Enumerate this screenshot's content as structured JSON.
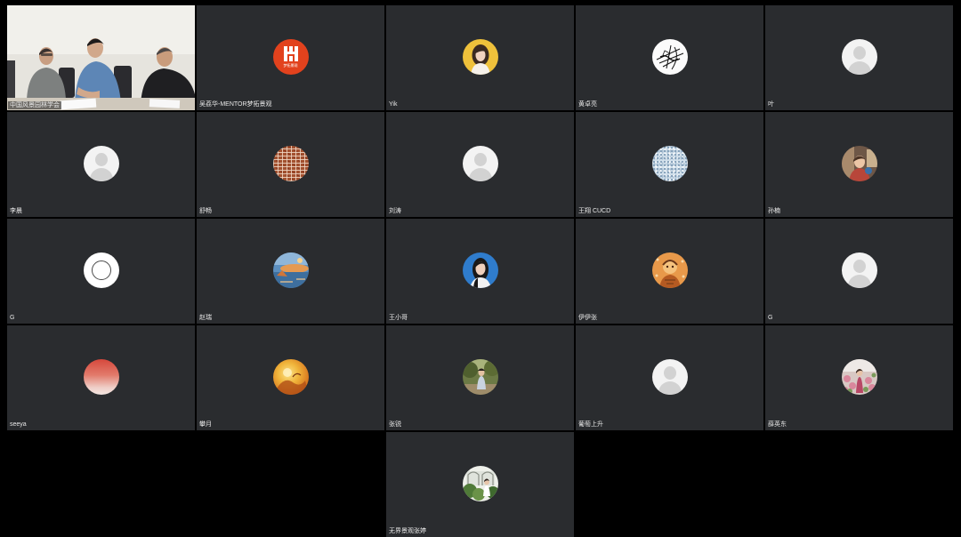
{
  "meeting": {
    "layout": "gallery",
    "colors": {
      "background": "#000000",
      "tile": "#2a2c2f",
      "active_border": "#8fd39a",
      "label": "#e8e8e8"
    }
  },
  "participants": [
    {
      "name": "中国风景园林学会",
      "avatar": "camera-video",
      "active_speaker": true
    },
    {
      "name": "吴荔华-MENTOR梦拓景观",
      "avatar": "logo-image",
      "logo_text": "梦拓景观"
    },
    {
      "name": "Yik",
      "avatar": "photo-avatar"
    },
    {
      "name": "黄卓亮",
      "avatar": "sketch-avatar"
    },
    {
      "name": "叶",
      "avatar": "default-avatar-icon"
    },
    {
      "name": "李晨",
      "avatar": "default-avatar-icon"
    },
    {
      "name": "舒畅",
      "avatar": "pattern-avatar"
    },
    {
      "name": "刘涛",
      "avatar": "default-avatar-icon"
    },
    {
      "name": "王翔 CUCD",
      "avatar": "pattern-avatar"
    },
    {
      "name": "孙楠",
      "avatar": "photo-avatar"
    },
    {
      "name": "G",
      "avatar": "ring-avatar"
    },
    {
      "name": "赵瑞",
      "avatar": "painting-avatar"
    },
    {
      "name": "王小哥",
      "avatar": "photo-avatar"
    },
    {
      "name": "伊伊张",
      "avatar": "illustration-avatar"
    },
    {
      "name": "G",
      "avatar": "default-avatar-icon"
    },
    {
      "name": "seeya",
      "avatar": "gradient-avatar"
    },
    {
      "name": "攀月",
      "avatar": "illustration-avatar"
    },
    {
      "name": "张锐",
      "avatar": "photo-avatar"
    },
    {
      "name": "葡萄上升",
      "avatar": "default-avatar-icon"
    },
    {
      "name": "薛英东",
      "avatar": "photo-avatar"
    },
    {
      "name": "无界景观张婷",
      "avatar": "photo-avatar"
    }
  ]
}
